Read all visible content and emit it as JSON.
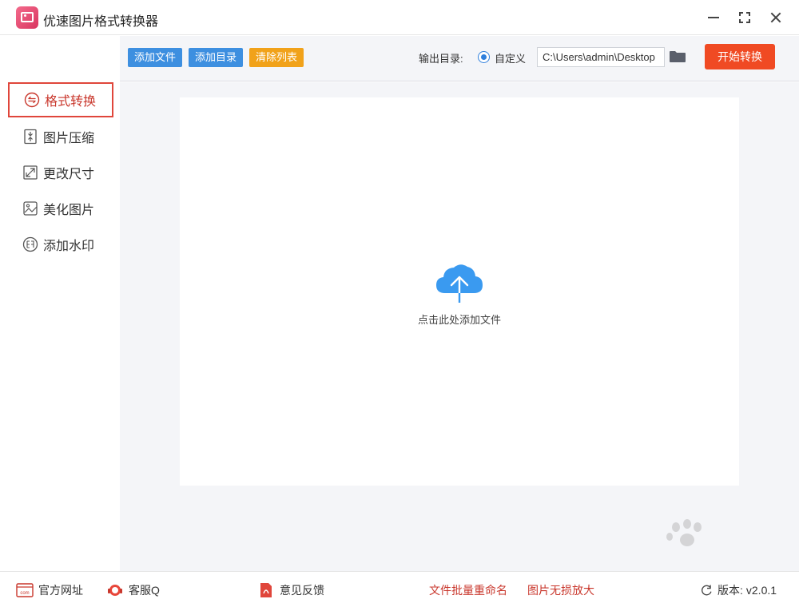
{
  "app": {
    "title": "优速图片格式转换器"
  },
  "window_controls": [
    "minimize-icon",
    "maximize-icon",
    "close-icon"
  ],
  "sidebar": {
    "items": [
      {
        "label": "格式转换",
        "icon": "convert-icon",
        "active": true
      },
      {
        "label": "图片压缩",
        "icon": "compress-icon",
        "active": false
      },
      {
        "label": "更改尺寸",
        "icon": "resize-icon",
        "active": false
      },
      {
        "label": "美化图片",
        "icon": "beautify-icon",
        "active": false
      },
      {
        "label": "添加水印",
        "icon": "watermark-icon",
        "active": false
      }
    ]
  },
  "toolbar": {
    "add_file": "添加文件",
    "add_folder": "添加目录",
    "clear_list": "清除列表",
    "output_label": "输出目录:",
    "output_option": "自定义",
    "output_path": "C:\\Users\\admin\\Desktop",
    "start_button": "开始转换"
  },
  "dropzone": {
    "text": "点击此处添加文件",
    "icon": "cloud-upload-icon"
  },
  "footer": {
    "website": "官方网址",
    "service": "客服Q",
    "feedback": "意见反馈",
    "batch_rename": "文件批量重命名",
    "lossless_enlarge": "图片无损放大",
    "version_label": "版本:",
    "version": "v2.0.1"
  },
  "colors": {
    "accent_blue": "#3d8fe0",
    "accent_orange": "#f1a21a",
    "start_red": "#f04a23",
    "active_red": "#c9372c",
    "panel_bg": "#f4f5f8"
  }
}
